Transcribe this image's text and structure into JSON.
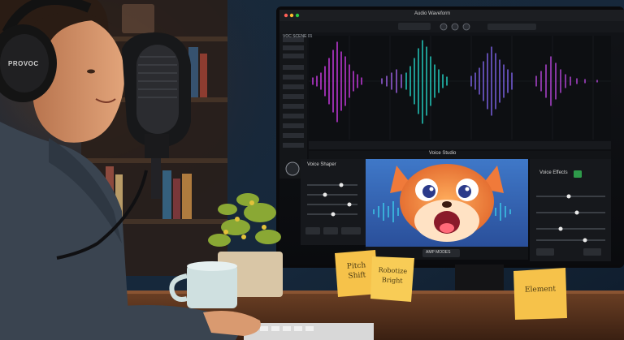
{
  "monitor": {
    "app_title": "Audio Waveform",
    "left_header": "VOC SCENE 01",
    "bottom_app_title": "Voice Studio",
    "left_panel_title": "Voice Shaper",
    "right_panel_title": "Voice Effects",
    "bottom_bar_btn": "AMP MODES"
  },
  "sticky_notes": [
    {
      "text_line1": "Pitch",
      "text_line2": "Shift"
    },
    {
      "text_line1": "Robotize",
      "text_line2": "Bright"
    },
    {
      "text_line1": "Element",
      "text_line2": ""
    }
  ],
  "headphones_brand": "PROVOC",
  "colors": {
    "wave_pink": "#e040fb",
    "wave_cyan": "#26e6d8",
    "wave_purple": "#8a6cff",
    "sticky": "#f6c24a"
  }
}
